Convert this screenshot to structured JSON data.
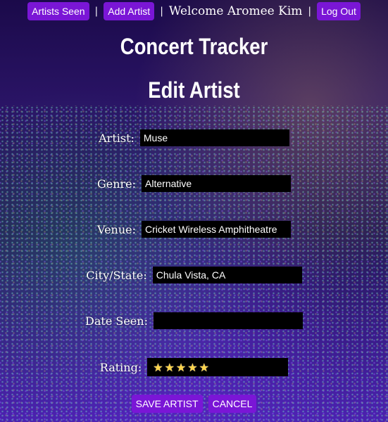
{
  "nav": {
    "artists_seen": "Artists Seen",
    "add_artist": "Add Artist",
    "separator": "|",
    "welcome": "Welcome Aromee Kim",
    "logout": "Log Out"
  },
  "app_title": "Concert Tracker",
  "page_title": "Edit Artist",
  "form": {
    "artist": {
      "label": "Artist:",
      "value": "Muse"
    },
    "genre": {
      "label": "Genre:",
      "value": "Alternative"
    },
    "venue": {
      "label": "Venue:",
      "value": "Cricket Wireless Amphitheatre"
    },
    "city_state": {
      "label": "City/State:",
      "value": "Chula Vista, CA"
    },
    "date_seen": {
      "label": "Date Seen:",
      "value": ""
    },
    "rating": {
      "label": "Rating:",
      "value": 5,
      "max": 5,
      "star_char": "★"
    }
  },
  "buttons": {
    "save": "SAVE ARTIST",
    "cancel": "CANCEL"
  },
  "colors": {
    "accent": "#7a16d6",
    "field_bg": "#000000",
    "star": "#ffd54a"
  }
}
